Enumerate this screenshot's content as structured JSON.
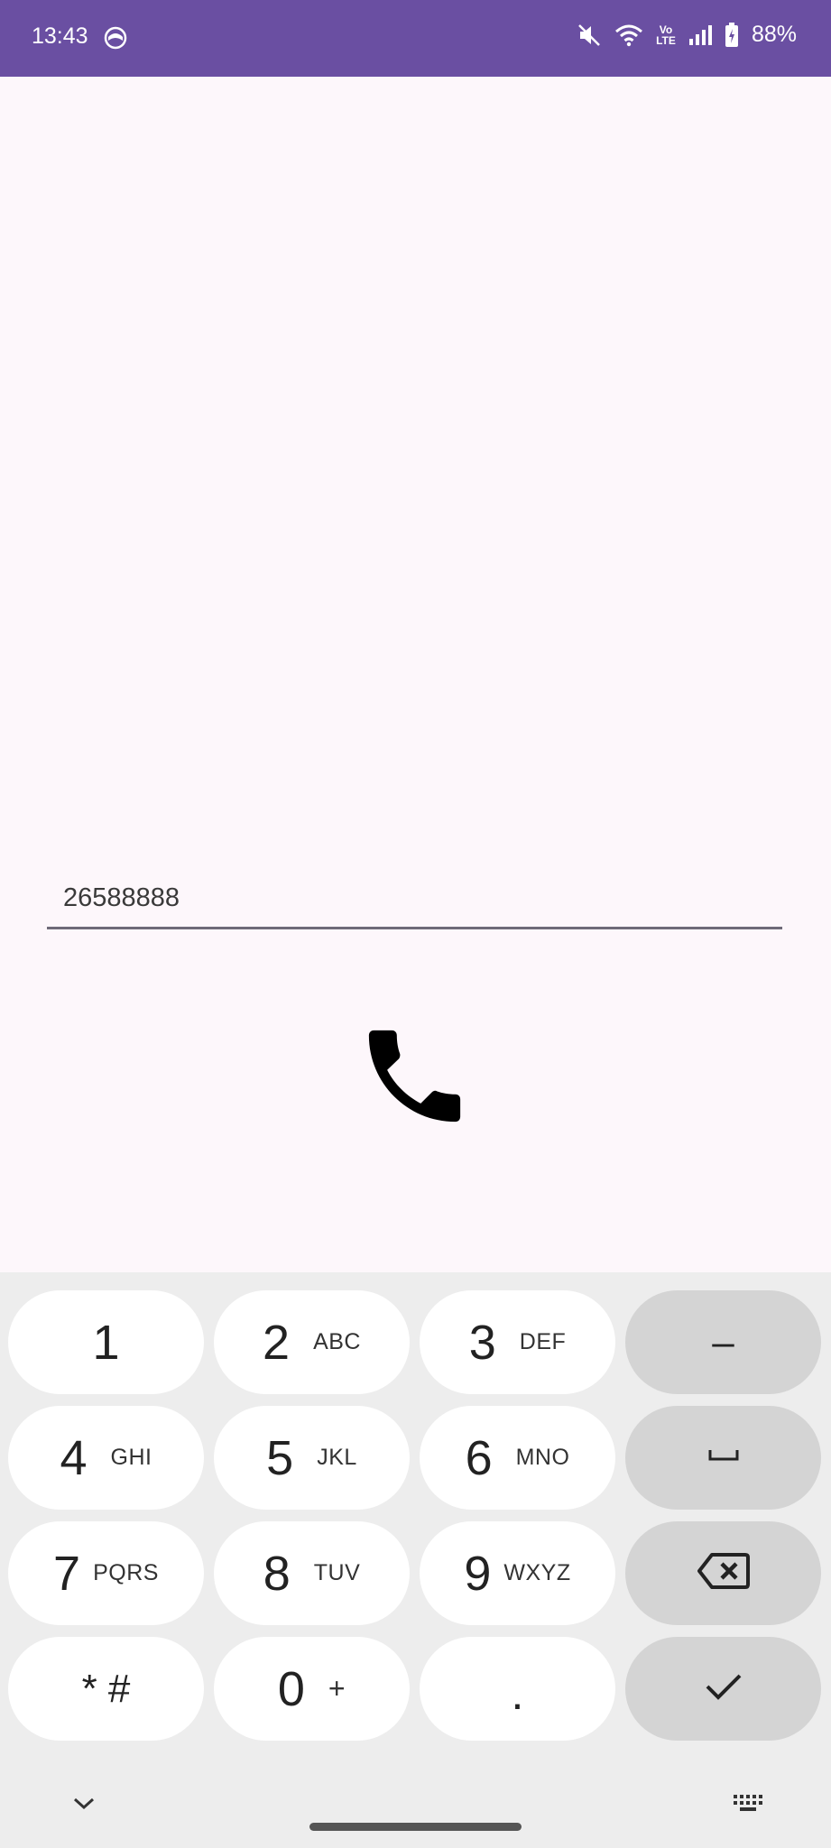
{
  "status_bar": {
    "time": "13:43",
    "network_label": "Vo LTE",
    "battery": "88%"
  },
  "dialer": {
    "number_value": "26588888",
    "call_icon": "phone-icon"
  },
  "keypad": {
    "rows": [
      [
        {
          "main": "1",
          "sub": ""
        },
        {
          "main": "2",
          "sub": "ABC"
        },
        {
          "main": "3",
          "sub": "DEF"
        },
        {
          "main": "–",
          "sub": ""
        }
      ],
      [
        {
          "main": "4",
          "sub": "GHI"
        },
        {
          "main": "5",
          "sub": "JKL"
        },
        {
          "main": "6",
          "sub": "MNO"
        },
        {
          "main": "␣",
          "sub": ""
        }
      ],
      [
        {
          "main": "7",
          "sub": "PQRS"
        },
        {
          "main": "8",
          "sub": "TUV"
        },
        {
          "main": "9",
          "sub": "WXYZ"
        },
        {
          "main": "backspace",
          "sub": ""
        }
      ],
      [
        {
          "main": "* #",
          "sub": ""
        },
        {
          "main": "0",
          "sub": "+"
        },
        {
          "main": ".",
          "sub": ""
        },
        {
          "main": "✓",
          "sub": ""
        }
      ]
    ]
  },
  "colors": {
    "status_bar": "#6a4fa2",
    "background": "#fdf7fb",
    "keyboard": "#ededed",
    "key": "#ffffff",
    "function_key": "#d4d4d4"
  }
}
